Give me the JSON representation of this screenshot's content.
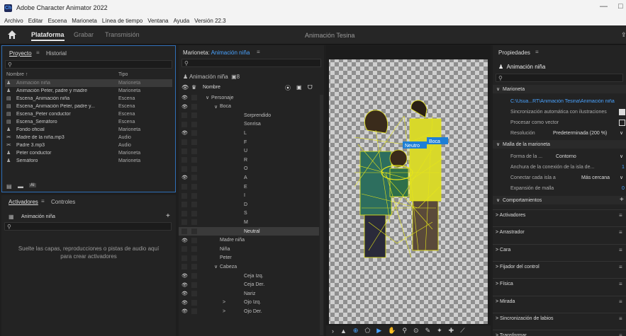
{
  "window": {
    "title": "Adobe Character Animator 2022",
    "app_icon_label": "Ch",
    "minimize": "—",
    "maximize": "□"
  },
  "menu": [
    "Archivo",
    "Editar",
    "Escena",
    "Marioneta",
    "Línea de tiempo",
    "Ventana",
    "Ayuda",
    "Versión 22.3"
  ],
  "workspaces": {
    "items": [
      "Plataforma",
      "Grabar",
      "Transmisión"
    ],
    "active": "Plataforma",
    "project_name": "Animación Tesina"
  },
  "project_panel": {
    "tabs": [
      "Proyecto",
      "Historial"
    ],
    "col_name": "Nombre",
    "col_type": "Tipo",
    "items": [
      {
        "name": "Animación niña",
        "type": "Marioneta",
        "icon": "puppet-icon",
        "selected": true
      },
      {
        "name": "Animación Peter, padre y madre",
        "type": "Marioneta",
        "icon": "puppet-icon"
      },
      {
        "name": "Escena_Animación niña",
        "type": "Escena",
        "icon": "scene-icon"
      },
      {
        "name": "Escena_Animación Peter, padre y...",
        "type": "Escena",
        "icon": "scene-icon"
      },
      {
        "name": "Escena_Peter conductor",
        "type": "Escena",
        "icon": "scene-icon"
      },
      {
        "name": "Escena_Semáforo",
        "type": "Escena",
        "icon": "scene-icon"
      },
      {
        "name": "Fondo oficial",
        "type": "Marioneta",
        "icon": "puppet-icon"
      },
      {
        "name": "Madre de la niña.mp3",
        "type": "Audio",
        "icon": "audio-icon"
      },
      {
        "name": "Padre 3.mp3",
        "type": "Audio",
        "icon": "audio-icon"
      },
      {
        "name": "Peter conductor",
        "type": "Marioneta",
        "icon": "puppet-icon"
      },
      {
        "name": "Semáforo",
        "type": "Marioneta",
        "icon": "puppet-icon"
      }
    ],
    "footer_badge": "AI"
  },
  "triggers_panel": {
    "tabs": [
      "Activadores",
      "Controles"
    ],
    "puppet": "Animación niña",
    "add": "+",
    "drop_hint": "Suelte las capas, reproducciones o pistas de audio aquí para crear activadores"
  },
  "puppet_panel": {
    "label": "Marioneta:",
    "puppet": "Animación niña",
    "header_name": "Animación niña",
    "header_count": "8",
    "col_name": "Nombre",
    "rows": [
      {
        "text": "Personaje",
        "indent": 1,
        "eye": true,
        "chevron": "∨"
      },
      {
        "text": "Boca",
        "indent": 2,
        "eye": true,
        "chevron": "∨"
      },
      {
        "text": "Sorprendido",
        "indent": 3,
        "eye": false
      },
      {
        "text": "Sonrisa",
        "indent": 3,
        "eye": false
      },
      {
        "text": "L",
        "indent": 3,
        "eye": true
      },
      {
        "text": "F",
        "indent": 3,
        "eye": false
      },
      {
        "text": "U",
        "indent": 3,
        "eye": false
      },
      {
        "text": "R",
        "indent": 3,
        "eye": false
      },
      {
        "text": "O",
        "indent": 3,
        "eye": false
      },
      {
        "text": "A",
        "indent": 3,
        "eye": true
      },
      {
        "text": "E",
        "indent": 3,
        "eye": false
      },
      {
        "text": "I",
        "indent": 3,
        "eye": false
      },
      {
        "text": "D",
        "indent": 3,
        "eye": false
      },
      {
        "text": "S",
        "indent": 3,
        "eye": false
      },
      {
        "text": "M",
        "indent": 3,
        "eye": false
      },
      {
        "text": "Neutral",
        "indent": 3,
        "eye": false,
        "selected": true
      },
      {
        "text": "Madre niña",
        "indent": 2,
        "eye": true
      },
      {
        "text": "Niña",
        "indent": 2,
        "eye": false
      },
      {
        "text": "Peter",
        "indent": 2,
        "eye": false
      },
      {
        "text": "Cabeza",
        "indent": 2,
        "eye": false,
        "chevron": "∨"
      },
      {
        "text": "Ceja Izq.",
        "indent": 3,
        "eye": true
      },
      {
        "text": "Ceja Der.",
        "indent": 3,
        "eye": true
      },
      {
        "text": "Nariz",
        "indent": 3,
        "eye": true
      },
      {
        "text": "Ojo Izq.",
        "indent": 3,
        "eye": true,
        "chevron": ">"
      },
      {
        "text": "Ojo Der.",
        "indent": 3,
        "eye": true,
        "chevron": ">"
      }
    ]
  },
  "canvas": {
    "tag_neutral": "Neutro",
    "tag_boca": "Boca"
  },
  "properties_panel": {
    "title": "Propiedades",
    "puppet": "Animación niña",
    "marioneta_header": "Marioneta",
    "path": "C:\\Usua...RT\\Animación Tesina\\Animación niña",
    "sync_label": "Sincronización automática con ilustraciones",
    "vector_label": "Procesar como vector",
    "resolution_label": "Resolución",
    "resolution_value": "Predeterminada (200 %)",
    "mesh_header": "Malla de la marioneta",
    "mesh_form_label": "Forma de la ...",
    "mesh_form_value": "Contorno",
    "island_width_label": "Anchura de la conexión de la isla de...",
    "island_width_value": "1",
    "connect_label": "Conectar cada isla a",
    "connect_value": "Más cercana",
    "expansion_label": "Expansión de malla",
    "expansion_value": "0",
    "behaviors_header": "Comportamientos",
    "behaviors": [
      "Activadores",
      "Arrastrador",
      "Cara",
      "Fijador del control",
      "Física",
      "Mirada",
      "Sincronización de labios",
      "Transformar"
    ]
  },
  "colors": {
    "accent": "#4aa3ff",
    "mesh": "#e6e619",
    "panel": "#232323",
    "selected_row": "#3a3a3a"
  }
}
